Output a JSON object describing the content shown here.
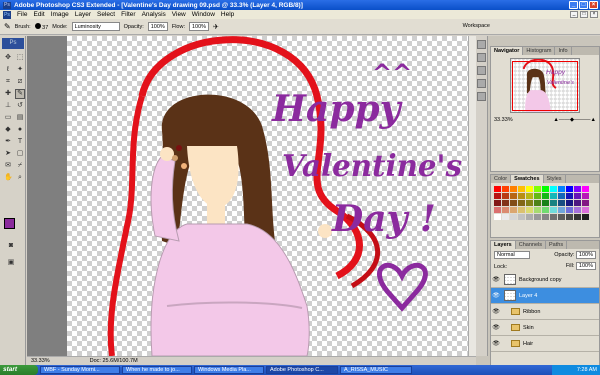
{
  "window": {
    "title": "Adobe Photoshop CS3 Extended - [Valentine's Day drawing 09.psd @ 33.3% (Layer 4, RGB/8)]"
  },
  "menu": [
    "File",
    "Edit",
    "Image",
    "Layer",
    "Select",
    "Filter",
    "Analysis",
    "View",
    "Window",
    "Help"
  ],
  "options": {
    "brush_label": "Brush:",
    "brush_size": "37",
    "mode_label": "Mode:",
    "mode_value": "Luminosity",
    "opacity_label": "Opacity:",
    "opacity_value": "100%",
    "flow_label": "Flow:",
    "flow_value": "100%",
    "workspace": "Workspace"
  },
  "toolbox": {
    "logo": "Ps"
  },
  "canvas": {
    "greeting": [
      "Happy",
      "Valentine's",
      "Day !"
    ],
    "face": "^^",
    "colors": {
      "ribbon": "#e3111a",
      "text": "#8b2a9e",
      "hair": "#5a3217",
      "dress": "#f3c8e8",
      "skin": "#fce4c4"
    }
  },
  "status": {
    "zoom": "33.33%",
    "doc": "Doc: 25.6M/100.7M"
  },
  "navigator": {
    "tabs": [
      "Navigator",
      "Histogram",
      "Info"
    ],
    "zoom": "33.33%"
  },
  "swatches": {
    "tabs": [
      "Color",
      "Swatches",
      "Styles"
    ]
  },
  "layers": {
    "tabs": [
      "Layers",
      "Channels",
      "Paths"
    ],
    "blend_mode": "Normal",
    "opacity_label": "Opacity:",
    "opacity_value": "100%",
    "lock_label": "Lock:",
    "fill_label": "Fill:",
    "fill_value": "100%",
    "items": [
      {
        "name": "Background copy",
        "type": "layer",
        "selected": false
      },
      {
        "name": "Layer 4",
        "type": "layer",
        "selected": true
      },
      {
        "name": "Ribbon",
        "type": "folder",
        "selected": false
      },
      {
        "name": "Skin",
        "type": "folder",
        "selected": false
      },
      {
        "name": "Hair",
        "type": "folder",
        "selected": false
      }
    ]
  },
  "taskbar": {
    "start": "start",
    "tasks": [
      "WBF - Sunday Morni...",
      "When he made to jo...",
      "Windows Media Pla...",
      "Adobe Photoshop C...",
      "A_RISSA_MUSIC"
    ],
    "clock": "7:28 AM"
  }
}
